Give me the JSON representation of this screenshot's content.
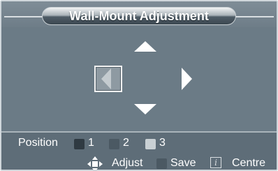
{
  "window": {
    "title": "Wall-Mount Adjustment"
  },
  "position": {
    "label": "Position",
    "slots": [
      {
        "label": "1",
        "color": "#2f3a42"
      },
      {
        "label": "2",
        "color": "#4b5963"
      },
      {
        "label": "3",
        "color": "#c9d0d4"
      }
    ]
  },
  "legend": {
    "adjust": {
      "label": "Adjust",
      "icon": "dpad-icon"
    },
    "save": {
      "label": "Save",
      "icon": "save-button-icon",
      "color": "#4b5963"
    },
    "centre": {
      "label": "Centre",
      "icon": "info-icon",
      "glyph": "i"
    }
  },
  "colors": {
    "background": "#6b7b86",
    "panel": "#5e6d78",
    "selected_arrow": "#c4cbcf",
    "arrow": "#ffffff"
  }
}
